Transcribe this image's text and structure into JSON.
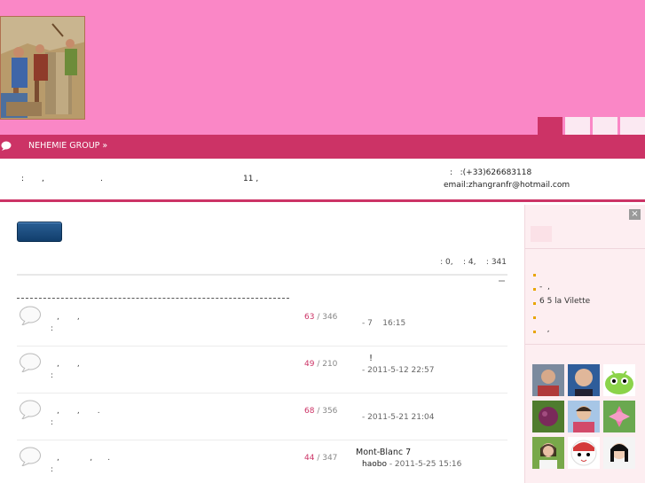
{
  "header": {
    "logo": "logo-image",
    "nav_tabs": [
      "",
      "",
      "",
      ""
    ]
  },
  "menubar": {
    "group_link": "NEHEMIE GROUP »"
  },
  "infobar": {
    "address_colon": ":",
    "address_comma": ",",
    "address_dot": ".",
    "address_number": "11 ,",
    "phone": ":   :(+33)626683118",
    "email": "email:zhangranfr@hotmail.com"
  },
  "main": {
    "post_button_label": "",
    "stats": ": 0,    : 4,    : 341"
  },
  "threads": [
    {
      "subject": ",       ,",
      "meta": ":",
      "replies": "63",
      "views": "346",
      "last_title": "",
      "last_user": "",
      "last_time": "- 7    16:15"
    },
    {
      "subject": ",       ,",
      "meta": ":",
      "replies": "49",
      "views": "210",
      "last_title": "     !",
      "last_user": "",
      "last_time": "- 2011-5-12 22:57"
    },
    {
      "subject": ",       ,       .",
      "meta": ":",
      "replies": "68",
      "views": "356",
      "last_title": "",
      "last_user": "",
      "last_time": "- 2011-5-21 21:04"
    },
    {
      "subject": ",            ,      .",
      "meta": ":",
      "replies": "44",
      "views": "347",
      "last_title": "Mont-Blanc 7",
      "last_user": "haobo",
      "last_time": " - 2011-5-25 15:16"
    }
  ],
  "sidebar": {
    "close_label": "×",
    "items": [
      "",
      "-  ,",
      "6 5 la Vilette",
      "",
      "   ,"
    ]
  },
  "colors": {
    "header": "#fa87c6",
    "accent": "#cc3366",
    "sidebar": "#fdeef1",
    "button": "#1a4a7a"
  }
}
